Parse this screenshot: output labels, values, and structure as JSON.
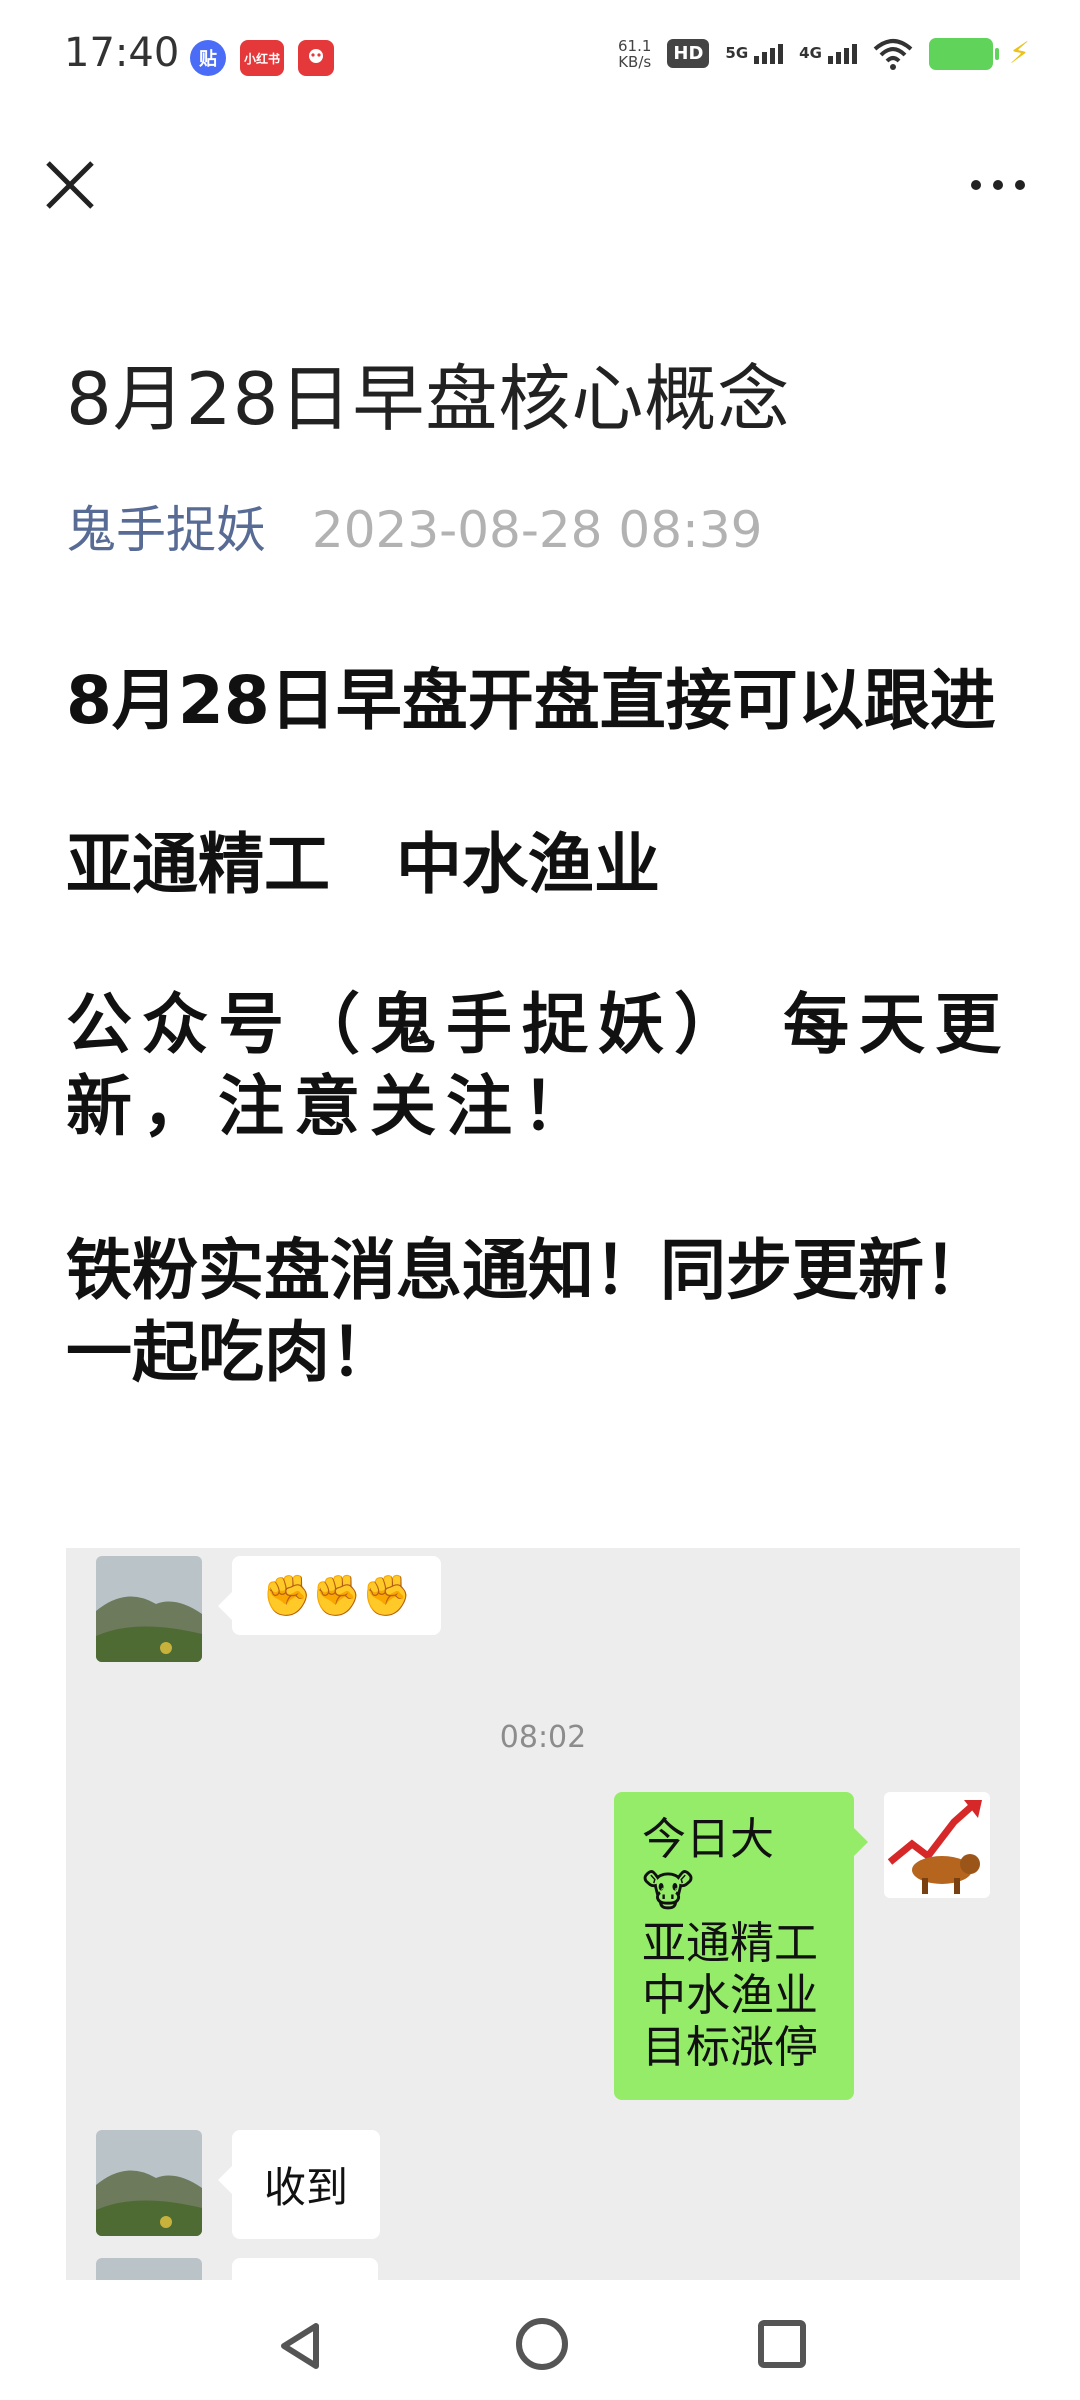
{
  "status_bar": {
    "time": "17:40",
    "notifications": [
      {
        "icon": "tieba-icon",
        "text": "贴"
      },
      {
        "icon": "xiaohongshu-icon",
        "text": "小红书"
      },
      {
        "icon": "app-icon",
        "text": ""
      }
    ],
    "net_speed_value": "61.1",
    "net_speed_unit": "KB/s",
    "hd_label": "HD",
    "signal_5g": "5G",
    "signal_4g": "4G",
    "battery_color": "#5fd35a"
  },
  "top_bar": {
    "close_icon": "close-icon",
    "more_icon": "more-icon"
  },
  "article": {
    "title": "8月28日早盘核心概念",
    "author": "鬼手捉妖",
    "date": "2023-08-28 08:39",
    "paragraphs": [
      "8月28日早盘开盘直接可以跟进",
      "亚通精工　中水渔业",
      "公众号（鬼手捉妖） 每天更新，注意关注！",
      "铁粉实盘消息通知！同步更新！一起吃肉！"
    ]
  },
  "chat": {
    "messages": [
      {
        "side": "left",
        "text": "✊✊✊"
      },
      {
        "type": "time",
        "text": "08:02"
      },
      {
        "side": "right",
        "text": "今日大🐮\n亚通精工\n中水渔业\n目标涨停"
      },
      {
        "side": "left",
        "text": "收到"
      }
    ],
    "background": "#ededed",
    "bubble_green": "#95ec69"
  },
  "nav_bar": {
    "back_icon": "back-triangle-icon",
    "home_icon": "home-circle-icon",
    "recents_icon": "recents-square-icon"
  }
}
